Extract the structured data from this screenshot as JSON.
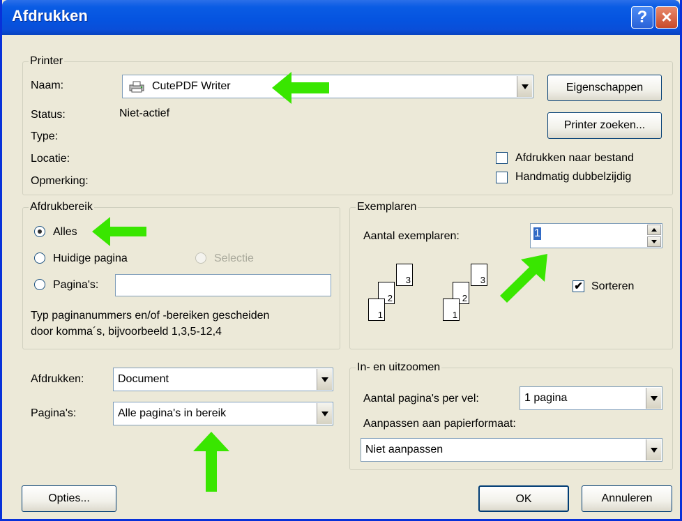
{
  "window": {
    "title": "Afdrukken",
    "help_label": "?",
    "close_label": "×"
  },
  "printer": {
    "legend": "Printer",
    "name_label": "Naam:",
    "name_value": "CutePDF Writer",
    "status_label": "Status:",
    "status_value": "Niet-actief",
    "type_label": "Type:",
    "location_label": "Locatie:",
    "comment_label": "Opmerking:",
    "properties_button": "Eigenschappen",
    "find_printer_button": "Printer zoeken...",
    "print_to_file_label": "Afdrukken naar bestand",
    "print_to_file_checked": false,
    "manual_duplex_label": "Handmatig dubbelzijdig",
    "manual_duplex_checked": false
  },
  "range": {
    "legend": "Afdrukbereik",
    "all_label": "Alles",
    "current_label": "Huidige pagina",
    "selection_label": "Selectie",
    "pages_label": "Pagina's:",
    "pages_value": "",
    "selected": "all",
    "help_line1": "Typ paginanummers en/of -bereiken gescheiden",
    "help_line2": "door komma´s, bijvoorbeeld 1,3,5-12,4"
  },
  "copies": {
    "legend": "Exemplaren",
    "count_label": "Aantal exemplaren:",
    "count_value": "1",
    "collate_label": "Sorteren",
    "collate_checked": true,
    "collate_check_glyph": "✔",
    "page_numbers": [
      "3",
      "2",
      "1"
    ]
  },
  "print_what": {
    "print_label": "Afdrukken:",
    "print_value": "Document",
    "pages_label": "Pagina's:",
    "pages_value": "Alle pagina's in bereik"
  },
  "zoom": {
    "legend": "In- en uitzoomen",
    "per_sheet_label": "Aantal pagina's per vel:",
    "per_sheet_value": "1 pagina",
    "scale_label": "Aanpassen aan papierformaat:",
    "scale_value": "Niet aanpassen"
  },
  "footer": {
    "options_button": "Opties...",
    "ok_button": "OK",
    "cancel_button": "Annuleren"
  },
  "colors": {
    "title_bar": "#0554e0",
    "dialog_bg": "#ece9d8",
    "arrow_green": "#39e600"
  }
}
